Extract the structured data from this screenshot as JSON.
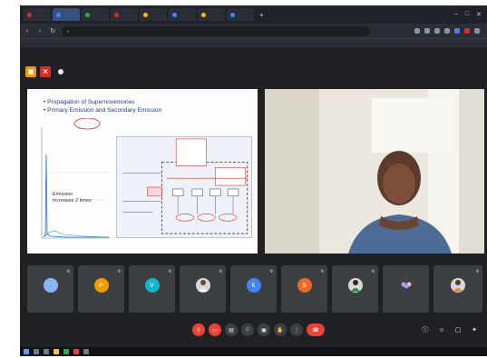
{
  "browser": {
    "tabs": [
      {
        "label": "",
        "active": false
      },
      {
        "label": "",
        "active": true
      },
      {
        "label": "",
        "active": false
      },
      {
        "label": "",
        "active": false
      },
      {
        "label": "",
        "active": false
      },
      {
        "label": "",
        "active": false
      },
      {
        "label": "",
        "active": false
      },
      {
        "label": "",
        "active": false
      }
    ],
    "new_tab_label": "+",
    "address": "",
    "bookmark_label": ""
  },
  "meeting": {
    "presenter_banner": "",
    "slide": {
      "bullet_1": "• Propagation of Supernovemories",
      "bullet_2": "• Primary Emission and Secondary Emission",
      "label_1": "Emission",
      "label_2": "increases 2 times"
    },
    "participants": [
      {
        "name": "",
        "avatar": "",
        "avatar_color": "#8ab4f8"
      },
      {
        "name": "",
        "avatar": "P",
        "avatar_color": "#f29900"
      },
      {
        "name": "",
        "avatar": "V",
        "avatar_color": "#12b5cb"
      },
      {
        "name": "",
        "avatar": "",
        "avatar_color": "#d7d7d7"
      },
      {
        "name": "",
        "avatar": "k",
        "avatar_color": "#4285f4"
      },
      {
        "name": "",
        "avatar": "S",
        "avatar_color": "#ea6a2b"
      },
      {
        "name": "",
        "avatar": "",
        "avatar_color": "#d7d7d7"
      },
      {
        "name": "",
        "avatar": "",
        "avatar_color": "#3c4043"
      },
      {
        "name": "",
        "avatar": "",
        "avatar_color": "#d7d7d7"
      }
    ],
    "time_and_code": ""
  },
  "icons": {
    "mic_off": "mic-off-icon",
    "cam_off": "camera-off-icon",
    "captions": "captions-icon",
    "emoji": "emoji-icon",
    "present": "present-icon",
    "hand": "raise-hand-icon",
    "more": "more-options-icon",
    "hangup": "hang-up-icon",
    "info": "info-icon",
    "people": "people-icon",
    "chat": "chat-icon",
    "activities": "activities-icon"
  },
  "colors": {
    "accent_red": "#ea4335",
    "meet_bg": "#202124",
    "tile_bg": "#3c4043"
  }
}
